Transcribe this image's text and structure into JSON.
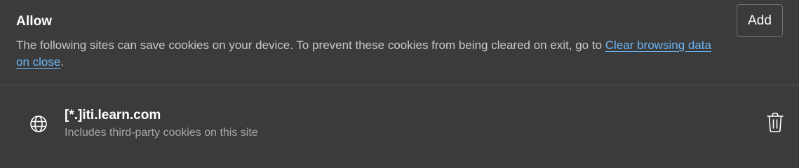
{
  "section": {
    "title": "Allow",
    "add_label": "Add",
    "description_prefix": "The following sites can save cookies on your device. To prevent these cookies from being cleared on exit, go to ",
    "description_link": "Clear browsing data on close",
    "description_suffix": "."
  },
  "sites": [
    {
      "name": "[*.]iti.learn.com",
      "detail": "Includes third-party cookies on this site",
      "icon": "globe-icon",
      "action_icon": "trash-icon"
    }
  ],
  "colors": {
    "background": "#3b3b3b",
    "link": "#6cb4f2",
    "divider": "#505050"
  }
}
